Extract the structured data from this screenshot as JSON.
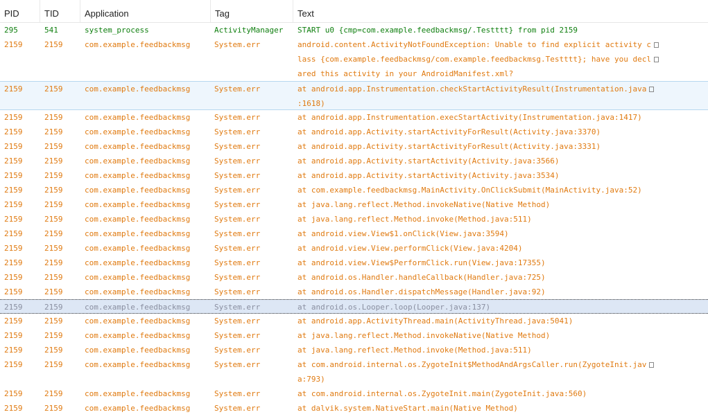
{
  "headers": {
    "pid": "PID",
    "tid": "TID",
    "application": "Application",
    "tag": "Tag",
    "text": "Text"
  },
  "colors": {
    "info": "#0f7f0f",
    "error": "#e07a10",
    "selected_bg": "#dde7f5",
    "highlight_bg": "#eef6fd"
  },
  "rows": [
    {
      "pid": "295",
      "tid": "541",
      "app": "system_process",
      "tag": "ActivityManager",
      "level": "info",
      "text": [
        "START u0 {cmp=com.example.feedbackmsg/.Testttt} from pid 2159"
      ]
    },
    {
      "pid": "2159",
      "tid": "2159",
      "app": "com.example.feedbackmsg",
      "tag": "System.err",
      "level": "error",
      "text": [
        "android.content.ActivityNotFoundException: Unable to find explicit activity c",
        "lass {com.example.feedbackmsg/com.example.feedbackmsg.Testttt}; have you decl",
        "ared this activity in your AndroidManifest.xml?"
      ]
    },
    {
      "pid": "2159",
      "tid": "2159",
      "app": "com.example.feedbackmsg",
      "tag": "System.err",
      "level": "error",
      "highlight": "light",
      "text": [
        "at android.app.Instrumentation.checkStartActivityResult(Instrumentation.java",
        ":1618)"
      ]
    },
    {
      "pid": "2159",
      "tid": "2159",
      "app": "com.example.feedbackmsg",
      "tag": "System.err",
      "level": "error",
      "text": [
        "at android.app.Instrumentation.execStartActivity(Instrumentation.java:1417)"
      ]
    },
    {
      "pid": "2159",
      "tid": "2159",
      "app": "com.example.feedbackmsg",
      "tag": "System.err",
      "level": "error",
      "text": [
        "at android.app.Activity.startActivityForResult(Activity.java:3370)"
      ]
    },
    {
      "pid": "2159",
      "tid": "2159",
      "app": "com.example.feedbackmsg",
      "tag": "System.err",
      "level": "error",
      "text": [
        "at android.app.Activity.startActivityForResult(Activity.java:3331)"
      ]
    },
    {
      "pid": "2159",
      "tid": "2159",
      "app": "com.example.feedbackmsg",
      "tag": "System.err",
      "level": "error",
      "text": [
        "at android.app.Activity.startActivity(Activity.java:3566)"
      ]
    },
    {
      "pid": "2159",
      "tid": "2159",
      "app": "com.example.feedbackmsg",
      "tag": "System.err",
      "level": "error",
      "text": [
        "at android.app.Activity.startActivity(Activity.java:3534)"
      ]
    },
    {
      "pid": "2159",
      "tid": "2159",
      "app": "com.example.feedbackmsg",
      "tag": "System.err",
      "level": "error",
      "text": [
        "at com.example.feedbackmsg.MainActivity.OnClickSubmit(MainActivity.java:52)"
      ]
    },
    {
      "pid": "2159",
      "tid": "2159",
      "app": "com.example.feedbackmsg",
      "tag": "System.err",
      "level": "error",
      "text": [
        "at java.lang.reflect.Method.invokeNative(Native Method)"
      ]
    },
    {
      "pid": "2159",
      "tid": "2159",
      "app": "com.example.feedbackmsg",
      "tag": "System.err",
      "level": "error",
      "text": [
        "at java.lang.reflect.Method.invoke(Method.java:511)"
      ]
    },
    {
      "pid": "2159",
      "tid": "2159",
      "app": "com.example.feedbackmsg",
      "tag": "System.err",
      "level": "error",
      "text": [
        "at android.view.View$1.onClick(View.java:3594)"
      ]
    },
    {
      "pid": "2159",
      "tid": "2159",
      "app": "com.example.feedbackmsg",
      "tag": "System.err",
      "level": "error",
      "text": [
        "at android.view.View.performClick(View.java:4204)"
      ]
    },
    {
      "pid": "2159",
      "tid": "2159",
      "app": "com.example.feedbackmsg",
      "tag": "System.err",
      "level": "error",
      "text": [
        "at android.view.View$PerformClick.run(View.java:17355)"
      ]
    },
    {
      "pid": "2159",
      "tid": "2159",
      "app": "com.example.feedbackmsg",
      "tag": "System.err",
      "level": "error",
      "text": [
        "at android.os.Handler.handleCallback(Handler.java:725)"
      ]
    },
    {
      "pid": "2159",
      "tid": "2159",
      "app": "com.example.feedbackmsg",
      "tag": "System.err",
      "level": "error",
      "text": [
        "at android.os.Handler.dispatchMessage(Handler.java:92)"
      ]
    },
    {
      "pid": "2159",
      "tid": "2159",
      "app": "com.example.feedbackmsg",
      "tag": "System.err",
      "level": "error",
      "highlight": "selected",
      "text": [
        "at android.os.Looper.loop(Looper.java:137)"
      ]
    },
    {
      "pid": "2159",
      "tid": "2159",
      "app": "com.example.feedbackmsg",
      "tag": "System.err",
      "level": "error",
      "text": [
        "at android.app.ActivityThread.main(ActivityThread.java:5041)"
      ]
    },
    {
      "pid": "2159",
      "tid": "2159",
      "app": "com.example.feedbackmsg",
      "tag": "System.err",
      "level": "error",
      "text": [
        "at java.lang.reflect.Method.invokeNative(Native Method)"
      ]
    },
    {
      "pid": "2159",
      "tid": "2159",
      "app": "com.example.feedbackmsg",
      "tag": "System.err",
      "level": "error",
      "text": [
        "at java.lang.reflect.Method.invoke(Method.java:511)"
      ]
    },
    {
      "pid": "2159",
      "tid": "2159",
      "app": "com.example.feedbackmsg",
      "tag": "System.err",
      "level": "error",
      "text": [
        "at com.android.internal.os.ZygoteInit$MethodAndArgsCaller.run(ZygoteInit.jav",
        "a:793)"
      ]
    },
    {
      "pid": "2159",
      "tid": "2159",
      "app": "com.example.feedbackmsg",
      "tag": "System.err",
      "level": "error",
      "text": [
        "at com.android.internal.os.ZygoteInit.main(ZygoteInit.java:560)"
      ]
    },
    {
      "pid": "2159",
      "tid": "2159",
      "app": "com.example.feedbackmsg",
      "tag": "System.err",
      "level": "error",
      "text": [
        "at dalvik.system.NativeStart.main(Native Method)"
      ]
    }
  ]
}
